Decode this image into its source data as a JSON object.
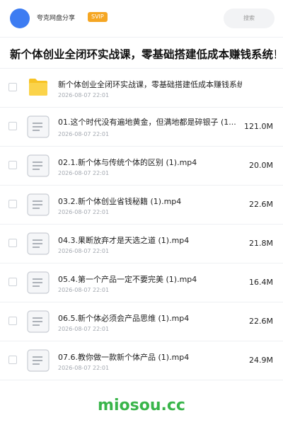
{
  "header": {
    "app_name": "夸克网盘分享",
    "badge": "SVIP",
    "search_placeholder": "搜索"
  },
  "page_title": "新个体创业全闭环实战课，零基础搭建低成本赚钱系统！",
  "items": [
    {
      "type": "folder",
      "name": "新个体创业全闭环实战课，零基础搭建低成本赚钱系统",
      "date": "2026-08-07 22:01",
      "size": ""
    },
    {
      "type": "file",
      "name": "01.这个时代没有遍地黄金，但满地都是碎银子 (1...",
      "date": "2026-08-07 22:01",
      "size": "121.0M"
    },
    {
      "type": "file",
      "name": "02.1.新个体与传统个体的区别 (1).mp4",
      "date": "2026-08-07 22:01",
      "size": "20.0M"
    },
    {
      "type": "file",
      "name": "03.2.新个体创业省钱秘籍 (1).mp4",
      "date": "2026-08-07 22:01",
      "size": "22.6M"
    },
    {
      "type": "file",
      "name": "04.3.果断放弃才是天选之道 (1).mp4",
      "date": "2026-08-07 22:01",
      "size": "21.8M"
    },
    {
      "type": "file",
      "name": "05.4.第一个产品一定不要完美 (1).mp4",
      "date": "2026-08-07 22:01",
      "size": "16.4M"
    },
    {
      "type": "file",
      "name": "06.5.新个体必须会产品思维 (1).mp4",
      "date": "2026-08-07 22:01",
      "size": "22.6M"
    },
    {
      "type": "file",
      "name": "07.6.教你做一款新个体产品 (1).mp4",
      "date": "2026-08-07 22:01",
      "size": "24.9M"
    }
  ],
  "footer": {
    "watermark": "miosou.cc"
  },
  "colors": {
    "accent": "#3d7cf2",
    "badge": "#f5a623",
    "folder": "#f7c325",
    "watermark": "#39b54a"
  }
}
